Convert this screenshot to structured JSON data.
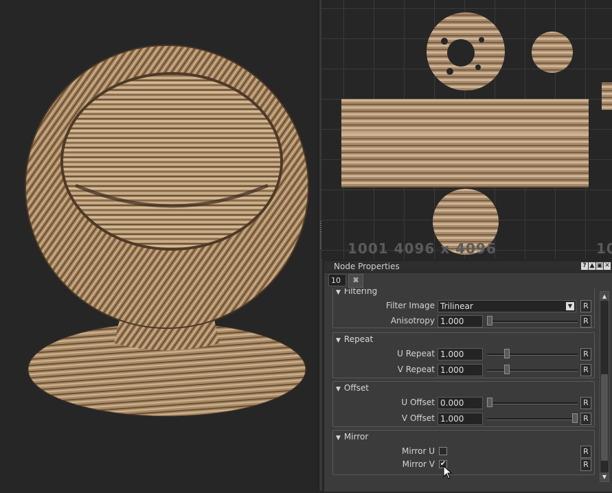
{
  "uv_view": {
    "tile_label": "1001 4096 x 4096",
    "next_tile_label": "10"
  },
  "panel": {
    "title": "Node Properties",
    "title_icons": [
      "help-icon",
      "float-icon",
      "restore-icon",
      "close-icon"
    ],
    "title_icon_glyphs": [
      "?",
      "▲",
      "▣",
      "✕"
    ],
    "depth_value": "10",
    "lock_icon_glyph": "⌘",
    "groups": {
      "filtering": {
        "title": "Filtering",
        "filter_image_label": "Filter Image",
        "filter_image_value": "Trilinear",
        "anisotropy_label": "Anisotropy",
        "anisotropy_value": "1.000",
        "anisotropy_slider": 0.0
      },
      "repeat": {
        "title": "Repeat",
        "u_label": "U Repeat",
        "u_value": "1.000",
        "u_slider": 0.2,
        "v_label": "V Repeat",
        "v_value": "1.000",
        "v_slider": 0.2
      },
      "offset": {
        "title": "Offset",
        "u_label": "U Offset",
        "u_value": "0.000",
        "u_slider": 0.0,
        "v_label": "V Offset",
        "v_value": "1.000",
        "v_slider": 1.0
      },
      "mirror": {
        "title": "Mirror",
        "u_label": "Mirror U",
        "u_checked": false,
        "v_label": "Mirror V",
        "v_checked": true
      }
    },
    "reset_label": "R",
    "triangle_glyph": "▼",
    "check_glyph": "✔",
    "dropdown_glyph": "▼",
    "scroll_up_glyph": "▲",
    "scroll_down_glyph": "▼"
  },
  "colors": {
    "wood_light": "#c9ab86",
    "wood_mid": "#9a7a56",
    "wood_dark": "#5e4630",
    "background": "#262626",
    "panel_bg": "#3b3b3b"
  }
}
